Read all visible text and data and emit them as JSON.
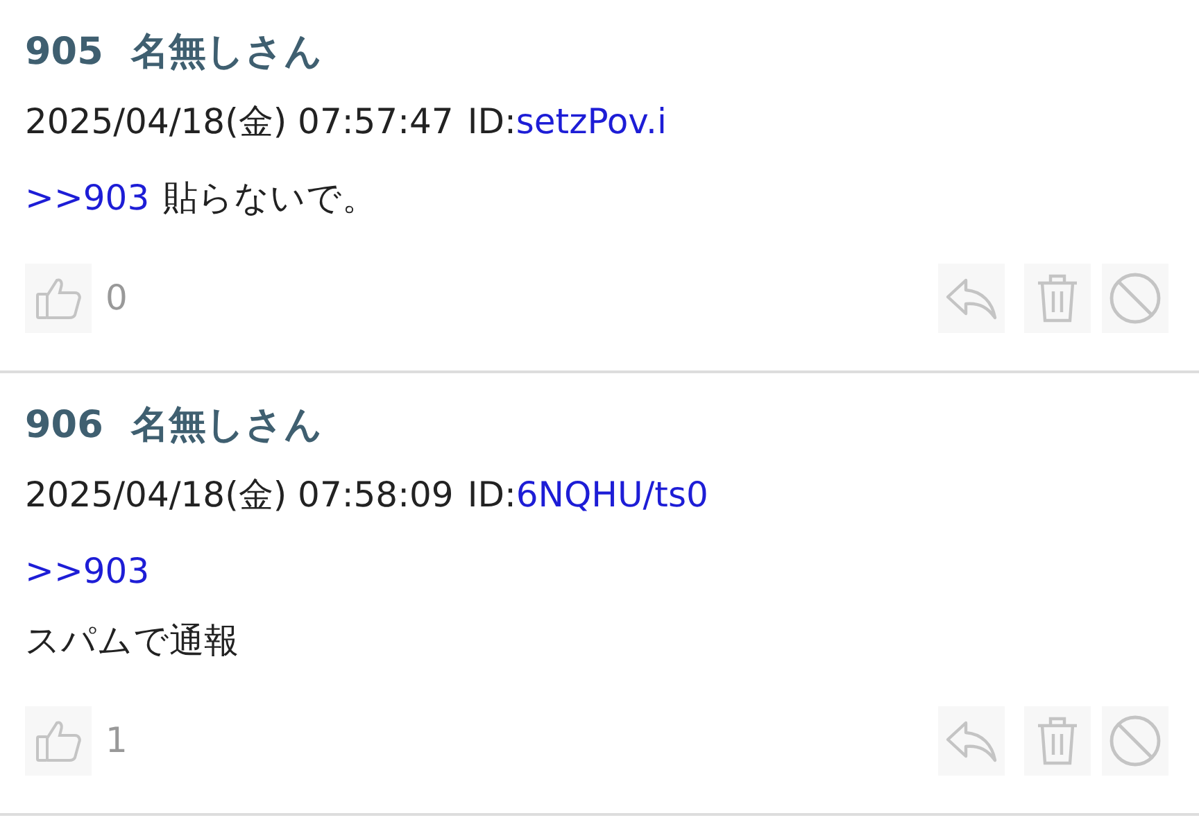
{
  "posts": [
    {
      "number": "905",
      "name": "名無しさん",
      "date": "2025/04/18(金) 07:57:47",
      "id_label": "ID:",
      "id": "setzPov.i",
      "lines": [
        [
          {
            "kind": "anchor",
            "text": ">>903"
          },
          {
            "kind": "text",
            "text": "貼らないで。"
          }
        ]
      ],
      "likes": "0"
    },
    {
      "number": "906",
      "name": "名無しさん",
      "date": "2025/04/18(金) 07:58:09",
      "id_label": "ID:",
      "id": "6NQHU/ts0",
      "lines": [
        [
          {
            "kind": "anchor",
            "text": ">>903"
          }
        ],
        [
          {
            "kind": "text",
            "text": "スパムで通報"
          }
        ]
      ],
      "likes": "1"
    }
  ]
}
